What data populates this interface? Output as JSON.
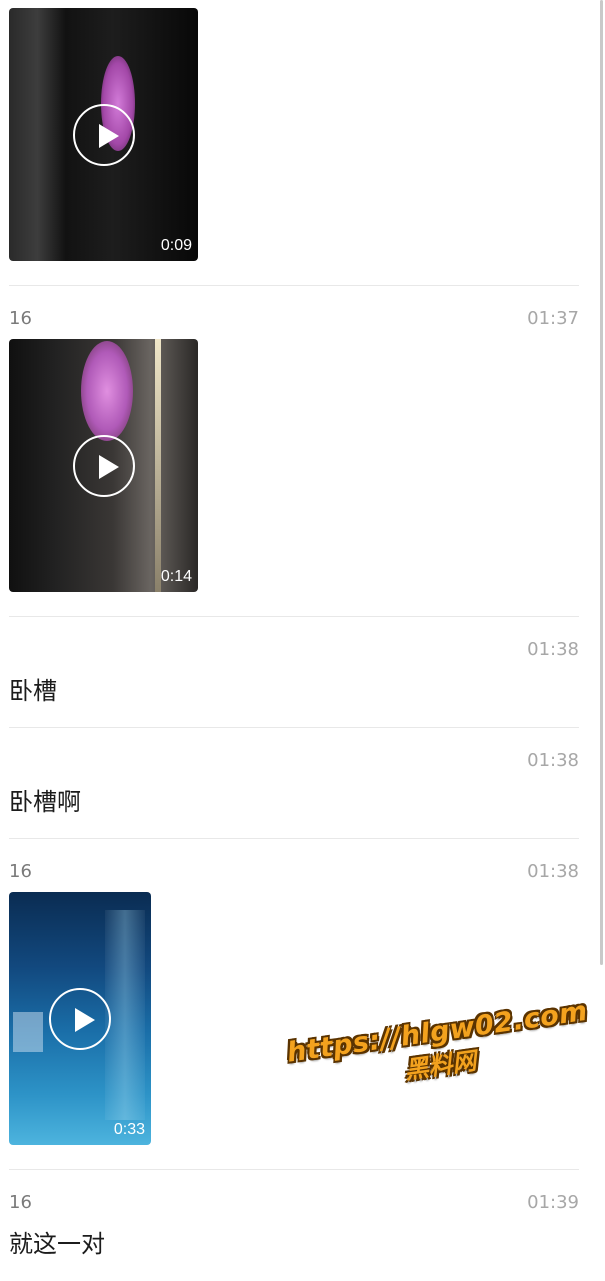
{
  "messages": [
    {
      "type": "video",
      "sender": "",
      "time": "",
      "duration": "0:09",
      "colors": [
        "#1c1c1c",
        "#4a4a4a",
        "#c04fc8"
      ]
    },
    {
      "type": "video",
      "sender": "16",
      "time": "01:37",
      "duration": "0:14",
      "colors": [
        "#141414",
        "#5a5655",
        "#c85fcf"
      ]
    },
    {
      "type": "text",
      "sender": "",
      "time": "01:38",
      "text": "卧槽"
    },
    {
      "type": "text",
      "sender": "",
      "time": "01:38",
      "text": "卧槽啊"
    },
    {
      "type": "video",
      "sender": "16",
      "time": "01:38",
      "duration": "0:33",
      "colors": [
        "#0e3b6b",
        "#1f7fb8",
        "#57b9e0"
      ]
    },
    {
      "type": "text",
      "sender": "16",
      "time": "01:39",
      "text": "就这一对"
    }
  ],
  "watermark": {
    "url": "https://hlgw02.com",
    "name": "黑料网"
  },
  "icons": {
    "play": "play-icon"
  }
}
